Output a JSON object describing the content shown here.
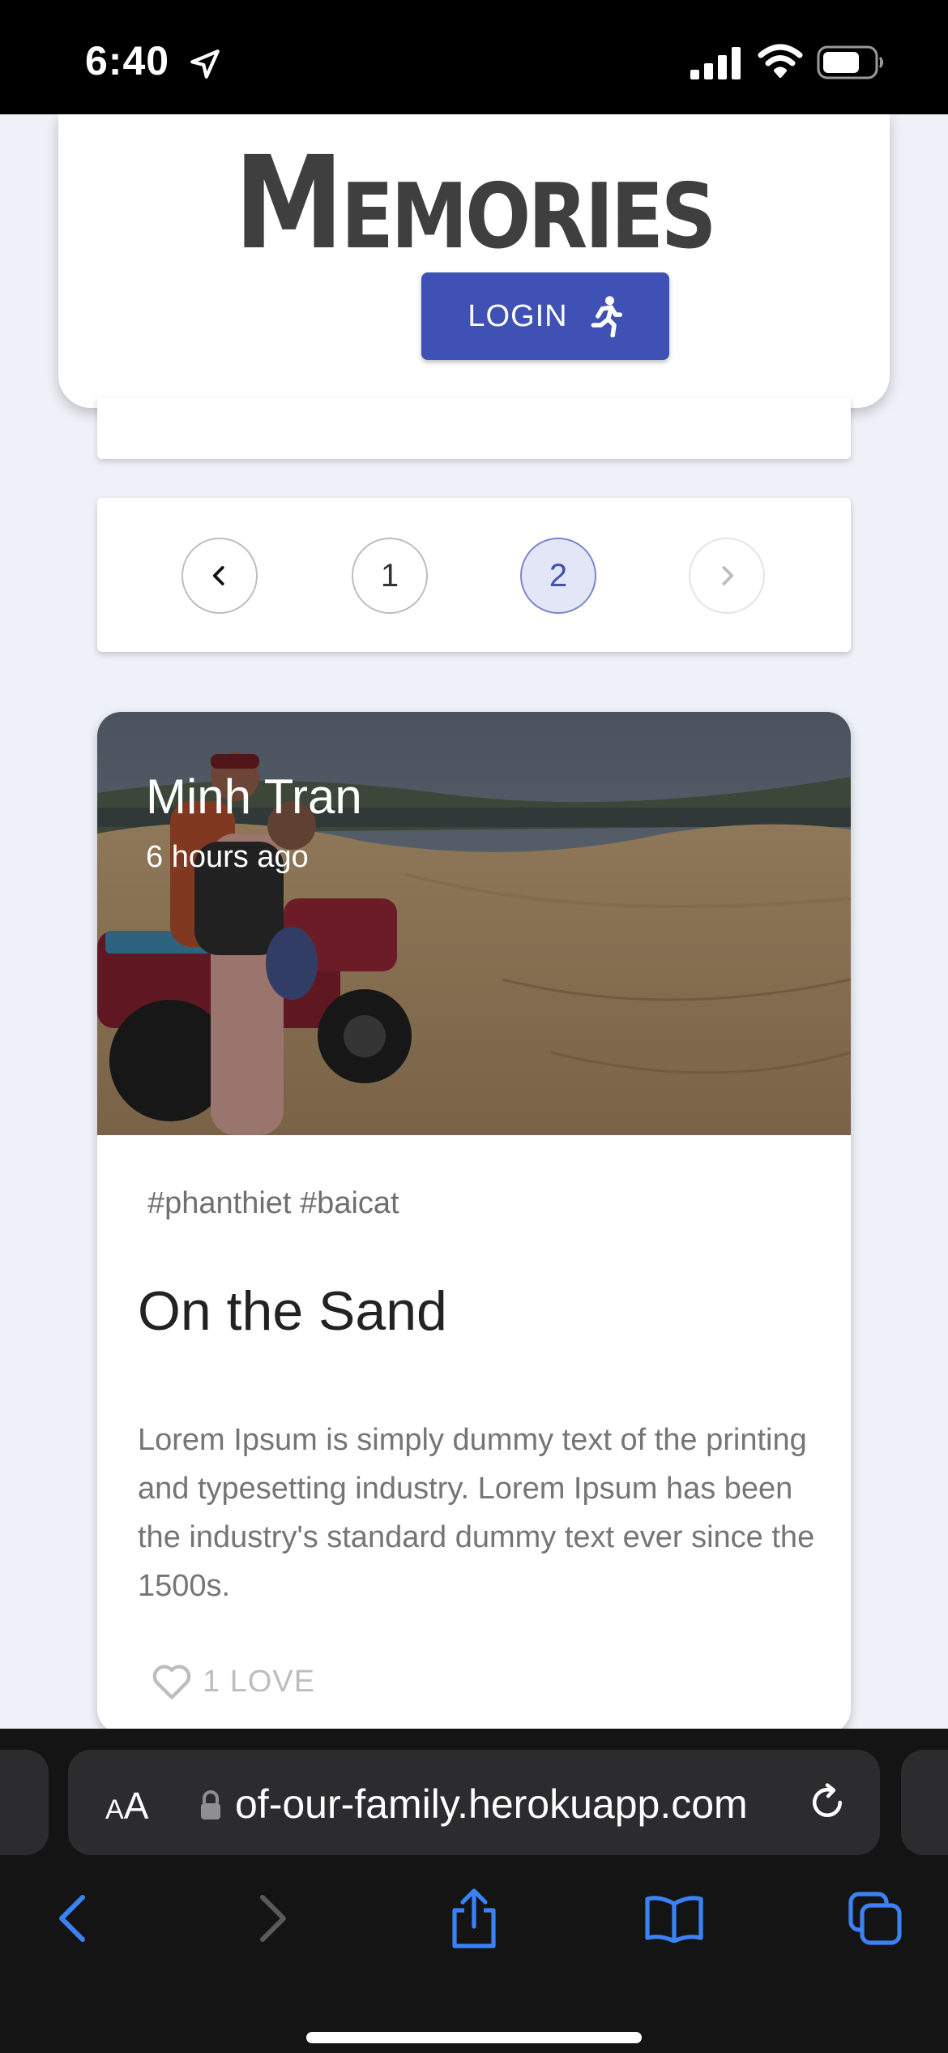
{
  "status_bar": {
    "time": "6:40",
    "icons": [
      "location-arrow-icon",
      "cellular-signal-icon",
      "wifi-icon",
      "battery-icon"
    ]
  },
  "header": {
    "title": "Memories",
    "login_label": "LOGIN",
    "login_icon": "running-person-icon",
    "accent_color": "#3f51b5"
  },
  "pagination": {
    "prev_icon": "chevron-left-icon",
    "pages": [
      "1",
      "2"
    ],
    "current_page": "2",
    "next_icon": "chevron-right-icon",
    "next_disabled": true
  },
  "post": {
    "author": "Minh Tran",
    "time_ago": "6 hours ago",
    "tags": "#phanthiet #baicat",
    "title": "On the Sand",
    "body": "Lorem Ipsum is simply dummy text of the printing and typesetting industry. Lorem Ipsum has been the industry's standard dummy text ever since the 1500s.",
    "like_label": "1 LOVE",
    "like_icon": "heart-outline-icon"
  },
  "browser": {
    "text_size_label": "AA",
    "url": "of-our-family.herokuapp.com",
    "icons": [
      "lock-icon",
      "reload-icon",
      "back-icon",
      "forward-icon",
      "share-icon",
      "bookmarks-icon",
      "tabs-icon"
    ]
  }
}
